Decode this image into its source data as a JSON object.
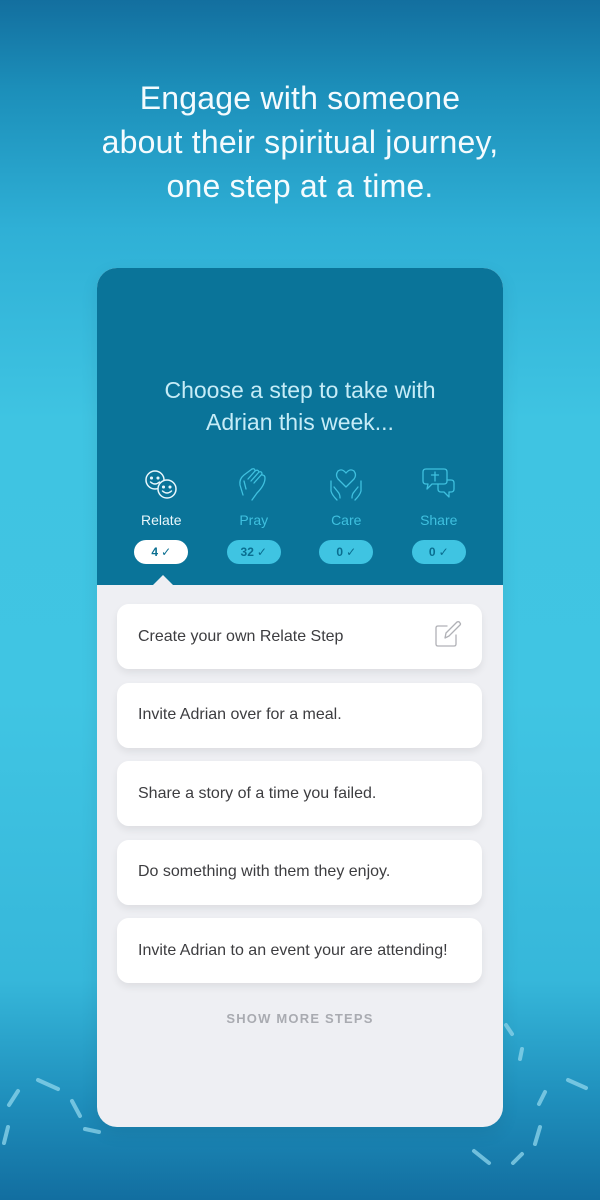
{
  "headline": {
    "lines": [
      "Engage with someone",
      "about their spiritual journey,",
      "one step at a time."
    ]
  },
  "card": {
    "prompt_lines": [
      "Choose a step to take with",
      "Adrian this week..."
    ],
    "categories": [
      {
        "label": "Relate",
        "count": "4",
        "icon": "two-smiley-faces-icon",
        "active": true
      },
      {
        "label": "Pray",
        "count": "32",
        "icon": "praying-hands-icon",
        "active": false
      },
      {
        "label": "Care",
        "count": "0",
        "icon": "heart-hands-icon",
        "active": false
      },
      {
        "label": "Share",
        "count": "0",
        "icon": "cross-speech-bubbles-icon",
        "active": false
      }
    ],
    "check_glyph": "✓",
    "steps": [
      {
        "text": "Create your own Relate Step",
        "icon": "edit-icon"
      },
      {
        "text": "Invite Adrian over for a meal."
      },
      {
        "text": "Share a story of a time you failed."
      },
      {
        "text": "Do something with them they enjoy."
      },
      {
        "text": "Invite Adrian to an event your are attending!"
      }
    ],
    "show_more_label": "SHOW MORE STEPS"
  },
  "colors": {
    "header_bg": "#0a7499",
    "accent": "#3fc4e2",
    "card_body": "#eeeff3"
  }
}
